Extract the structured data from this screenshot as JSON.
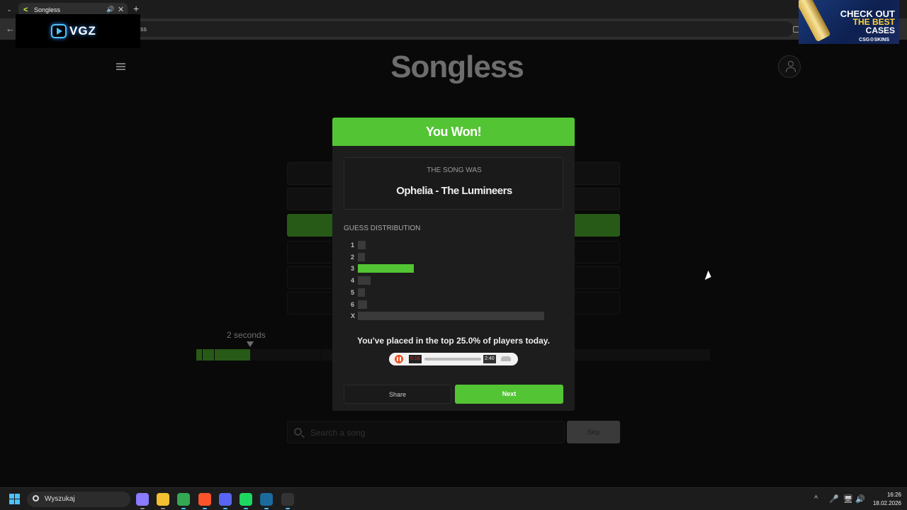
{
  "browser": {
    "tab_title": "Songless",
    "tab_favicon": "<",
    "tab_menu_icon": "⌄",
    "tab_audio_icon": "🔊",
    "tab_close_icon": "✕",
    "new_tab_icon": "+",
    "back_icon": "←",
    "url_fragment": "ss"
  },
  "overlays": {
    "vgz_text": "VGZ",
    "ad_line1": "CHECK OUT",
    "ad_line2": "THE BEST",
    "ad_line3": "CASES",
    "ad_brand": "CSG⚙SKINS"
  },
  "site": {
    "title": "Songless"
  },
  "game": {
    "timer_label": "2 seconds",
    "timer_progress": 0.105,
    "search_placeholder": "Search a song",
    "skip_label": "Skip",
    "guess_rows": [
      "filled",
      "filled",
      "correct",
      "empty",
      "empty",
      "empty"
    ]
  },
  "modal": {
    "header": "You Won!",
    "song_label": "THE SONG WAS",
    "song_name": "Ophelia - The Lumineers",
    "distribution_label": "GUESS DISTRIBUTION",
    "distribution": [
      {
        "label": "1",
        "value": 4
      },
      {
        "label": "2",
        "value": 3
      },
      {
        "label": "3",
        "value": 30,
        "highlight": true
      },
      {
        "label": "4",
        "value": 7
      },
      {
        "label": "5",
        "value": 3
      },
      {
        "label": "6",
        "value": 5
      },
      {
        "label": "X",
        "value": 100
      }
    ],
    "rank_text": "You've placed in the top 25.0% of players today.",
    "player": {
      "current_time": "0:16",
      "duration": "2:40"
    },
    "share_label": "Share",
    "next_label": "Next"
  },
  "taskbar": {
    "search_text": "Wyszukaj",
    "time": "16:26",
    "date": "18.02.2026",
    "tray_icons": [
      "^",
      "🎤",
      "🖥",
      "🔊"
    ],
    "apps": [
      {
        "name": "copilot",
        "color": "#8a7bff",
        "active": false
      },
      {
        "name": "explorer",
        "color": "#f2c031",
        "active": false
      },
      {
        "name": "chrome",
        "color": "#34a853",
        "active": true
      },
      {
        "name": "brave",
        "color": "#fb542b",
        "active": true
      },
      {
        "name": "discord",
        "color": "#5865f2",
        "active": true
      },
      {
        "name": "spotify",
        "color": "#1ed760",
        "active": true
      },
      {
        "name": "steam",
        "color": "#1b6a9c",
        "active": true
      },
      {
        "name": "opera-gx",
        "color": "#333333",
        "active": true
      }
    ]
  }
}
